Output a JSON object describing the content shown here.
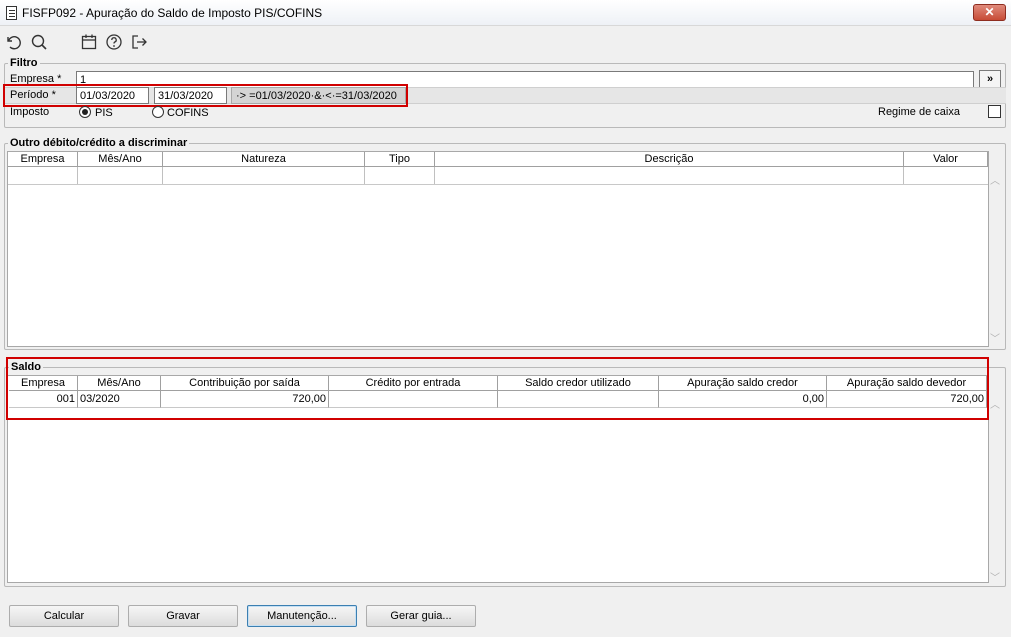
{
  "window": {
    "title": "FISFP092 - Apuração do Saldo de Imposto PIS/COFINS",
    "close_label": "✕"
  },
  "toolbar": {
    "icons": [
      "undo-icon",
      "search-icon",
      "calendar-icon",
      "help-icon",
      "exit-icon"
    ]
  },
  "filtro": {
    "title": "Filtro",
    "empresa_label": "Empresa *",
    "empresa_value": "1",
    "expand_label": "»",
    "periodo_label": "Período *",
    "periodo_from": "01/03/2020",
    "periodo_to": "31/03/2020",
    "periodo_expr": "·> =01/03/2020·&·<·=31/03/2020",
    "imposto_label": "Imposto",
    "imposto_options": [
      "PIS",
      "COFINS"
    ],
    "imposto_selected": "PIS",
    "regime_label": "Regime de caixa"
  },
  "outro": {
    "title": "Outro débito/crédito a discriminar",
    "columns": [
      "Empresa",
      "Mês/Ano",
      "Natureza",
      "Tipo",
      "Descrição",
      "Valor"
    ]
  },
  "saldo": {
    "title": "Saldo",
    "columns": [
      "Empresa",
      "Mês/Ano",
      "Contribuição por saída",
      "Crédito por entrada",
      "Saldo credor utilizado",
      "Apuração saldo credor",
      "Apuração saldo devedor"
    ],
    "rows": [
      [
        "001",
        "03/2020",
        "720,00",
        "",
        "",
        "0,00",
        "720,00"
      ]
    ]
  },
  "buttons": {
    "calcular": "Calcular",
    "gravar": "Gravar",
    "manutencao": "Manutenção...",
    "gerar_guia": "Gerar guia..."
  },
  "colors": {
    "highlight": "#d00000",
    "background": "#f0f0f0"
  }
}
